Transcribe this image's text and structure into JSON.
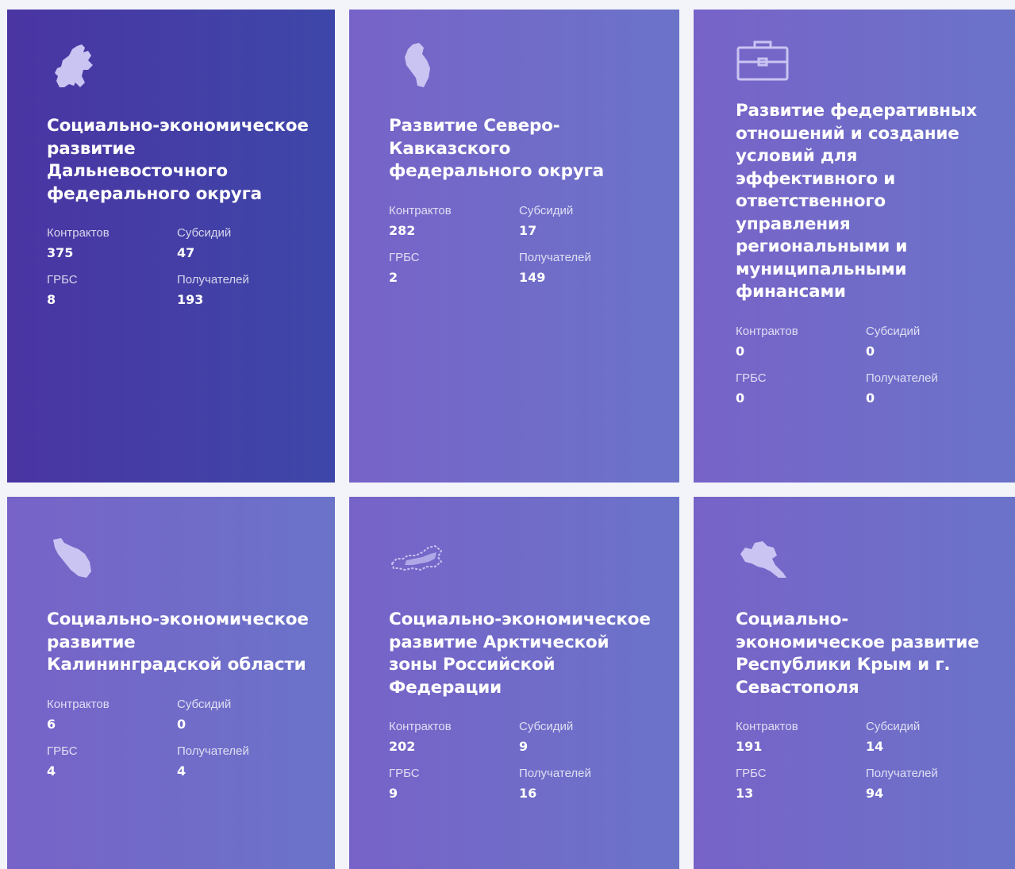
{
  "labels": {
    "contracts": "Контрактов",
    "subsidies": "Субсидий",
    "grbs": "ГРБС",
    "recipients": "Получателей"
  },
  "colors": {
    "card_dark_start": "#4a35a3",
    "card_dark_end": "#3e47a9",
    "card_light_start": "#7763c8",
    "card_light_end": "#6b73c9",
    "icon_fill": "#c9c4f2"
  },
  "cards": [
    {
      "icon": "far-east-map-icon",
      "title": "Социально-экономическое развитие Дальневосточного федерального округа",
      "contracts": "375",
      "subsidies": "47",
      "grbs": "8",
      "recipients": "193"
    },
    {
      "icon": "north-caucasus-map-icon",
      "title": "Развитие Северо-Кавказского федерального округа",
      "contracts": "282",
      "subsidies": "17",
      "grbs": "2",
      "recipients": "149"
    },
    {
      "icon": "briefcase-icon",
      "title": "Развитие федеративных отношений и создание условий для эффективного и ответственного управления региональными и муниципальными финансами",
      "contracts": "0",
      "subsidies": "0",
      "grbs": "0",
      "recipients": "0"
    },
    {
      "icon": "kaliningrad-map-icon",
      "title": "Социально-экономическое развитие Калининградской области",
      "contracts": "6",
      "subsidies": "0",
      "grbs": "4",
      "recipients": "4"
    },
    {
      "icon": "russia-arctic-map-icon",
      "title": "Социально-экономическое развитие Арктической зоны Российской Федерации",
      "contracts": "202",
      "subsidies": "9",
      "grbs": "9",
      "recipients": "16"
    },
    {
      "icon": "crimea-map-icon",
      "title": "Социально-экономическое развитие Республики Крым и г. Севастополя",
      "contracts": "191",
      "subsidies": "14",
      "grbs": "13",
      "recipients": "94"
    }
  ]
}
